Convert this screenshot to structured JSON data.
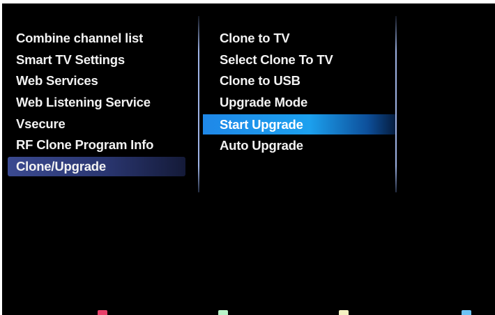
{
  "left_menu": {
    "items": [
      {
        "label": "Combine channel list"
      },
      {
        "label": "Smart TV Settings"
      },
      {
        "label": "Web Services"
      },
      {
        "label": "Web Listening Service"
      },
      {
        "label": "Vsecure"
      },
      {
        "label": "RF Clone Program Info"
      },
      {
        "label": "Clone/Upgrade",
        "state": "selected"
      }
    ]
  },
  "right_menu": {
    "items": [
      {
        "label": "Clone to TV"
      },
      {
        "label": "Select Clone To TV"
      },
      {
        "label": "Clone to USB"
      },
      {
        "label": "Upgrade Mode"
      },
      {
        "label": "Start Upgrade",
        "state": "focused"
      },
      {
        "label": "Auto Upgrade"
      }
    ]
  },
  "color_keys": [
    {
      "name": "red-key",
      "color": "#e8406a"
    },
    {
      "name": "green-key",
      "color": "#b9f2c8"
    },
    {
      "name": "yellow-key",
      "color": "#f5f1c2"
    },
    {
      "name": "blue-key",
      "color": "#6ec3f5"
    }
  ],
  "colors": {
    "background": "#000000",
    "text": "#f2f2f2",
    "focus_highlight": "#1ca0ee",
    "selected_path": "#3b4a90"
  }
}
